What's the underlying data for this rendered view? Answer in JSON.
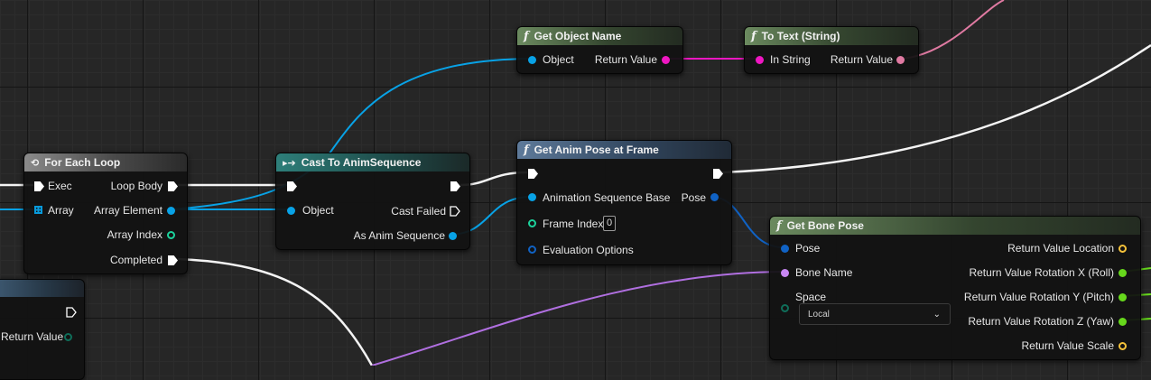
{
  "colors": {
    "exec_wire": "#ffffff",
    "object_pin": "#08a2e6",
    "struct_pin": "#1062c4",
    "string_pin": "#ef17c2",
    "text_pin": "#e07aa2",
    "name_pin": "#c887f3",
    "int_pin": "#1cd29c",
    "vector_pin": "#f6c23a",
    "rotator_pin": "#67d81c"
  },
  "nodes": {
    "for_each": {
      "title": "For Each Loop",
      "icon": "loop-icon",
      "exec_in": "Exec",
      "array_in": "Array",
      "loop_body": "Loop Body",
      "array_element": "Array Element",
      "array_index": "Array Index",
      "completed": "Completed"
    },
    "cast": {
      "title": "Cast To AnimSequence",
      "icon": "cast-icon",
      "object_in": "Object",
      "cast_failed": "Cast Failed",
      "as_anim": "As Anim Sequence"
    },
    "get_object_name": {
      "title": "Get Object Name",
      "icon": "function-icon",
      "object_in": "Object",
      "return_value": "Return Value"
    },
    "to_text": {
      "title": "To Text (String)",
      "icon": "function-icon",
      "in_string": "In String",
      "return_value": "Return Value"
    },
    "get_anim_pose": {
      "title": "Get Anim Pose at Frame",
      "icon": "function-icon",
      "anim_seq_base": "Animation Sequence Base",
      "pose": "Pose",
      "frame_index": "Frame Index",
      "frame_index_value": "0",
      "eval_options": "Evaluation Options"
    },
    "get_bone_pose": {
      "title": "Get Bone Pose",
      "icon": "function-icon",
      "pose": "Pose",
      "bone_name": "Bone Name",
      "space": "Space",
      "space_value": "Local",
      "rv_location": "Return Value Location",
      "rv_roll": "Return Value Rotation X (Roll)",
      "rv_pitch": "Return Value Rotation Y (Pitch)",
      "rv_yaw": "Return Value Rotation Z (Yaw)",
      "rv_scale": "Return Value Scale"
    },
    "partial_node": {
      "return_value": "Return Value"
    }
  }
}
